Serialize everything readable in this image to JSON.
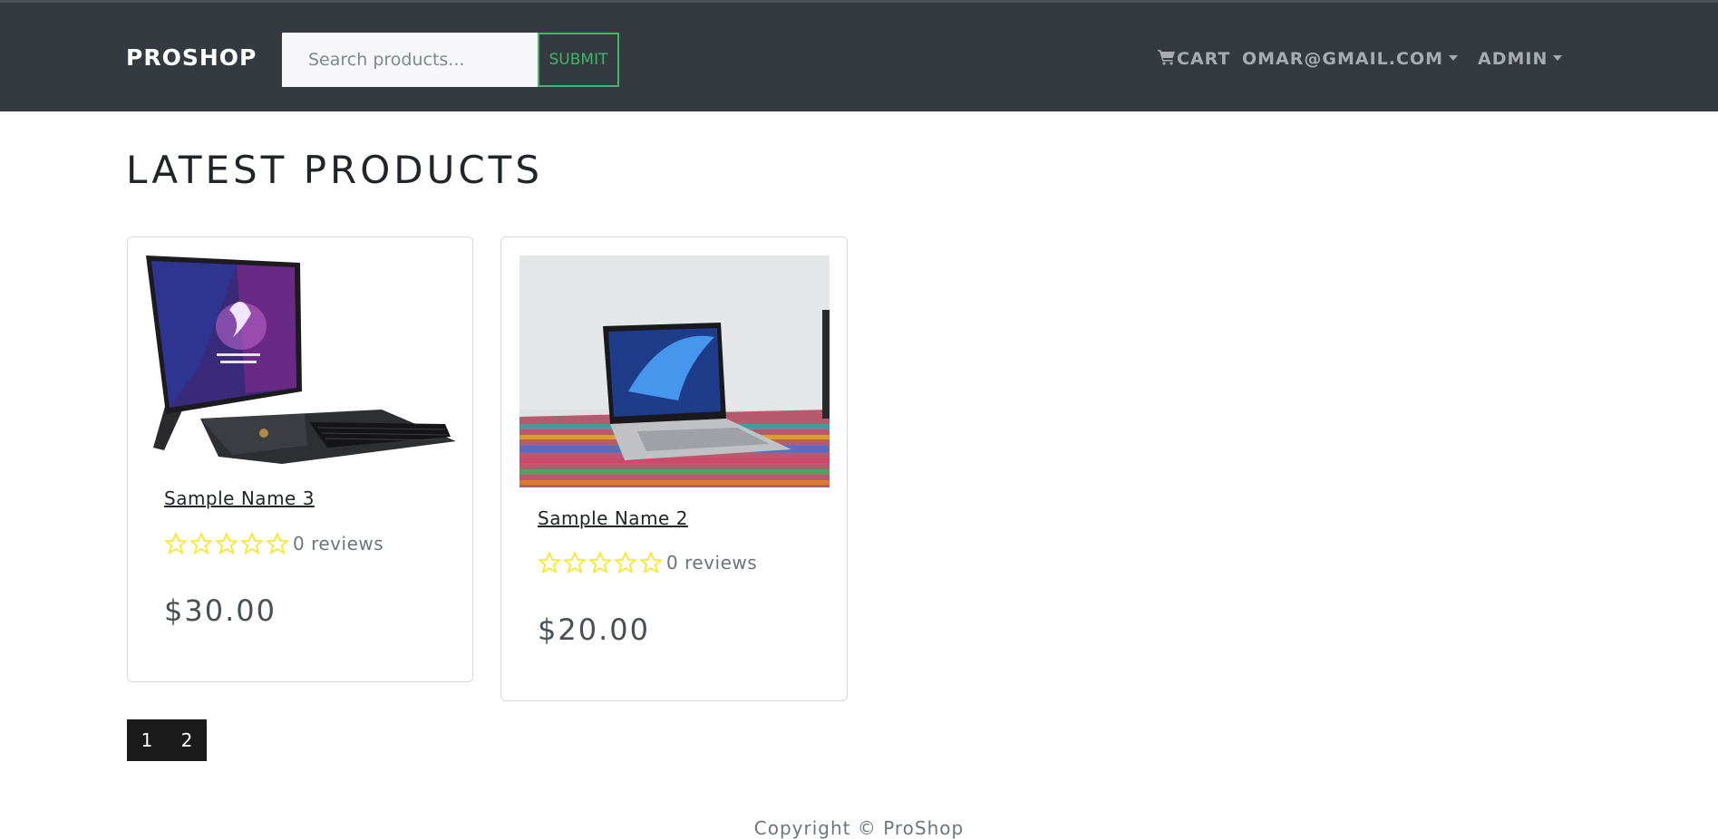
{
  "header": {
    "brand": "PROSHOP",
    "search_placeholder": "Search products...",
    "submit_label": "SUBMIT",
    "cart_label": "CART",
    "user_label": "OMAR@GMAIL.COM",
    "admin_label": "ADMIN"
  },
  "main": {
    "title": "LATEST PRODUCTS",
    "products": [
      {
        "name": "Sample Name 3",
        "rating": 0,
        "reviews": "0 reviews",
        "price": "$30.00",
        "image": "laptop-tablet-image"
      },
      {
        "name": "Sample Name 2",
        "rating": 0,
        "reviews": "0 reviews",
        "price": "$20.00",
        "image": "laptop-on-rug-image"
      }
    ]
  },
  "pagination": {
    "pages": [
      "1",
      "2"
    ]
  },
  "footer": {
    "text": "Copyright © ProShop"
  },
  "colors": {
    "navbar": "#343a40",
    "submit_accent": "#3fb668",
    "star": "#f8e825"
  }
}
